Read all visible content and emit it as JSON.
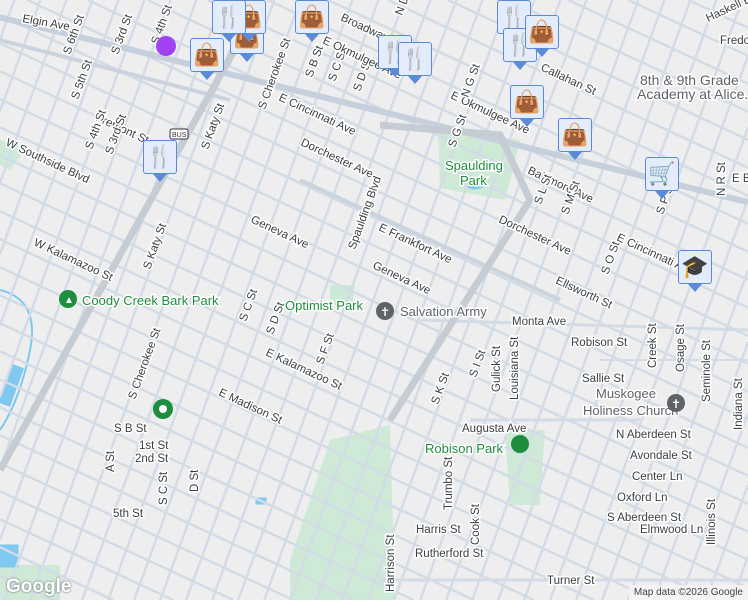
{
  "map": {
    "colors": {
      "background": "#eeeeee",
      "road": "#d3dce6",
      "major_road": "#c5d0dc",
      "park": "#ceead6",
      "water": "#7fc8f0",
      "marker_fill": "#e3ecfb",
      "marker_icon": "#0b4866"
    },
    "streets": [
      "Elgin Ave",
      "S 6th St",
      "S 5th St",
      "Fremont St",
      "S 4th St",
      "S 3rd St",
      "W Southside Blvd",
      "S Katy St",
      "S Cherokee St",
      "E Cincinnati Ave",
      "Dorchester Ave",
      "S B St",
      "S C St",
      "S D St",
      "E Okmulgee Ave",
      "Geneva Ave",
      "Spaulding Blvd",
      "E Frankfort Ave",
      "Geneva Ave",
      "W Kalamazoo St",
      "S Katy St",
      "Monta Ave",
      "Robison St",
      "Creek St",
      "Osage St",
      "Seminole St",
      "Sallie St",
      "Indiana St",
      "S C St",
      "S D St",
      "S F St",
      "E Kalamazoo St",
      "E Madison St",
      "S B St",
      "1st St",
      "2nd St",
      "S C St",
      "D St",
      "A St",
      "S Cherokee St",
      "5th St",
      "S K St",
      "S I St",
      "Gulick St",
      "Louisiana St",
      "Augusta Ave",
      "N Aberdeen St",
      "Avondale St",
      "Center Ln",
      "Oxford Ln",
      "S Aberdeen St",
      "Elmwood Ln",
      "Trumbo St",
      "Cook St",
      "Harris St",
      "Rutherford St",
      "Harrison St",
      "Turner St",
      "Illinois St",
      "Haskell Bl",
      "Fredo",
      "Callahan St",
      "Broadway St",
      "E Okmulgee Ave",
      "Baltimore Ave",
      "S G St",
      "N G St",
      "S L St",
      "S M St",
      "S O St",
      "S P St",
      "Dorchester Ave",
      "E Cincinnati Ave",
      "Ellsworth St",
      "N R St",
      "E B",
      "N D St",
      "S 4th St",
      "S 3rd St",
      "Muskogee"
    ],
    "places": {
      "coody": "Coody Creek Bark Park",
      "optimist": "Optimist Park",
      "salvation": "Salvation Army",
      "church1": "Muskogee",
      "church2": "Holiness Church",
      "robison": "Robison Park",
      "spaulding1": "Spaulding",
      "spaulding2": "Park",
      "school1": "8th & 9th Grade",
      "school2": "Academy at Alice..."
    },
    "shield": "BUS",
    "markers": [
      "shopping-bag",
      "shopping-bag",
      "shopping-bag",
      "shopping-bag",
      "restaurant",
      "restaurant",
      "restaurant",
      "restaurant",
      "shopping-bag",
      "shopping-bag",
      "shopping-cart",
      "school",
      "restaurant",
      "restaurant",
      "shopping-bag"
    ],
    "google_logo": "Google",
    "attribution": "Map data ©2026 Google"
  }
}
